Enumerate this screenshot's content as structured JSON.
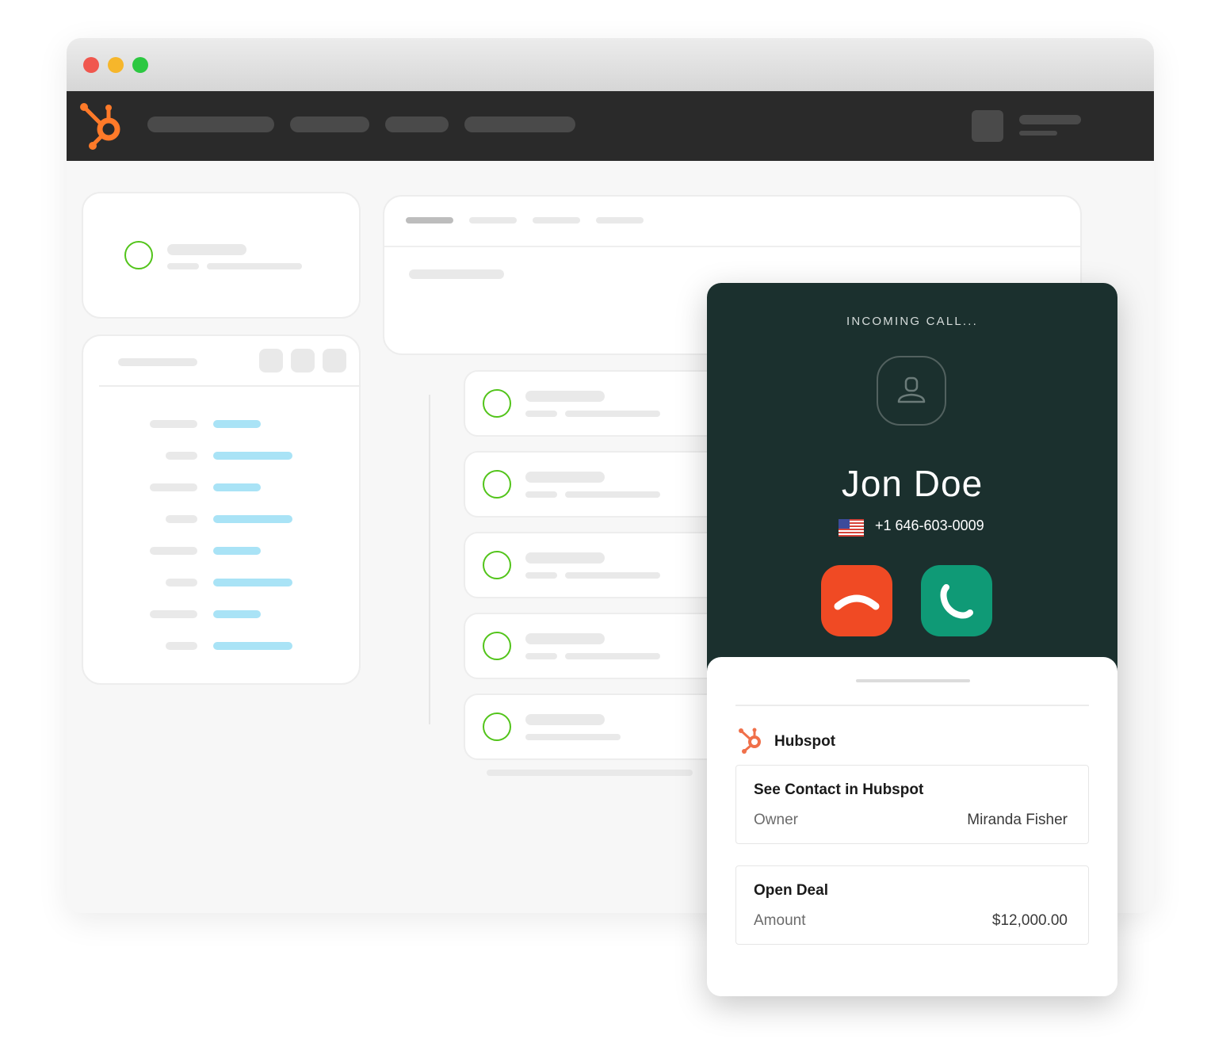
{
  "call": {
    "status": "INCOMING CALL...",
    "caller_name": "Jon Doe",
    "phone": "+1 646-603-0009",
    "country_flag": "us-flag-icon",
    "decline_color": "#f04a24",
    "accept_color": "#0f9a76"
  },
  "integration": {
    "name": "Hubspot",
    "contact_card": {
      "title": "See Contact in Hubspot",
      "label": "Owner",
      "value": "Miranda Fisher"
    },
    "deal_card": {
      "title": "Open Deal",
      "label": "Amount",
      "value": "$12,000.00"
    }
  },
  "colors": {
    "brand": "#ff7a29",
    "navbar": "#2a2a2a",
    "call_panel": "#1b302e",
    "status_green": "#52c41a",
    "link_blue": "#a9e3f6"
  }
}
